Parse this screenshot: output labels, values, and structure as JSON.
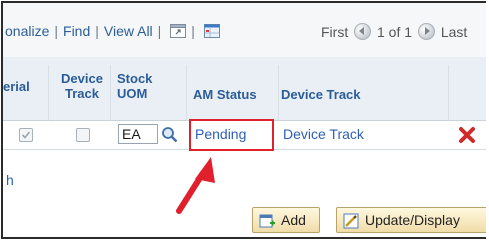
{
  "toolbar": {
    "links": [
      "onalize",
      "Find",
      "View All"
    ],
    "separator": "|"
  },
  "pagination": {
    "first": "First",
    "range": "1 of 1",
    "last": "Last"
  },
  "columns": {
    "serial": "erial",
    "device_track": "Device Track",
    "stock_uom": "Stock UOM",
    "am_status": "AM Status",
    "device_track_link": "Device Track"
  },
  "row": {
    "serial_checked": true,
    "device_track_checked": false,
    "stock_uom_value": "EA",
    "am_status": "Pending",
    "device_track_link": "Device Track"
  },
  "side_letter": "h",
  "buttons": {
    "add": "Add",
    "update_display": "Update/Display"
  },
  "colors": {
    "link": "#2d5fb6",
    "header_text": "#2b5d98",
    "highlight": "#e0202c",
    "delete_icon": "#d02b2b"
  }
}
